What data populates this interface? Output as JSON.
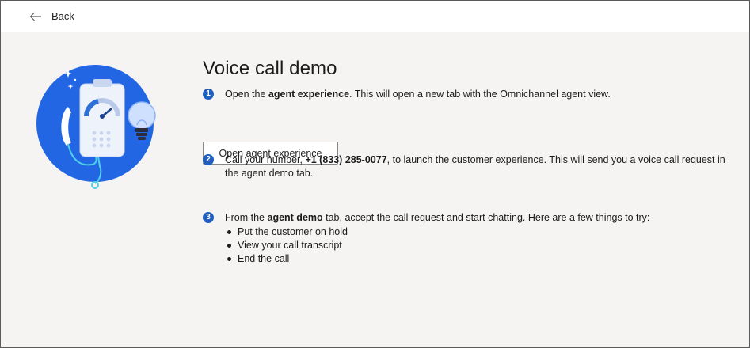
{
  "nav": {
    "back_label": "Back"
  },
  "page": {
    "title": "Voice call demo"
  },
  "steps": [
    {
      "number": "1",
      "before": "Open the ",
      "bold": "agent experience",
      "after": ". This will open a new tab with the Omnichannel agent view.",
      "button_label": "Open agent experience"
    },
    {
      "number": "2",
      "before": "Call your number, ",
      "bold": "+1 (833) 285-0077",
      "after": ", to launch the customer experience. This will send you a voice call request in the agent demo tab."
    },
    {
      "number": "3",
      "before": "From the ",
      "bold": "agent demo",
      "after": " tab, accept the call request and start chatting. Here are a few things to try:",
      "tips": [
        "Put the customer on hold",
        "View your call transcript",
        "End the call"
      ]
    }
  ],
  "colors": {
    "accent": "#1f5fbf",
    "illustration_circle": "#2266e3",
    "background": "#f5f4f3"
  }
}
